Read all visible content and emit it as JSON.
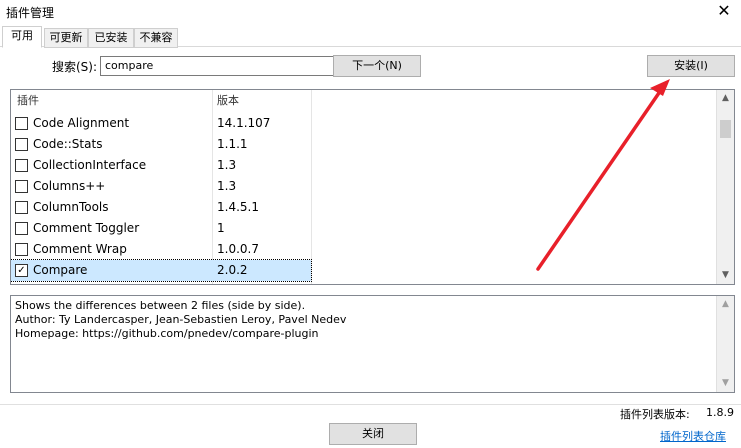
{
  "window": {
    "title": "插件管理"
  },
  "tabs": [
    {
      "label": "可用"
    },
    {
      "label": "可更新"
    },
    {
      "label": "已安装"
    },
    {
      "label": "不兼容"
    }
  ],
  "search": {
    "label": "搜索(S):",
    "value": "compare"
  },
  "buttons": {
    "next": "下一个(N)",
    "install": "安装(I)",
    "close": "关闭"
  },
  "list": {
    "headers": {
      "name": "插件",
      "version": "版本"
    },
    "rows": [
      {
        "name": "Code Alignment",
        "version": "14.1.107",
        "checked": ""
      },
      {
        "name": "Code::Stats",
        "version": "1.1.1",
        "checked": ""
      },
      {
        "name": "CollectionInterface",
        "version": "1.3",
        "checked": ""
      },
      {
        "name": "Columns++",
        "version": "1.3",
        "checked": ""
      },
      {
        "name": "ColumnTools",
        "version": "1.4.5.1",
        "checked": ""
      },
      {
        "name": "Comment Toggler",
        "version": "1",
        "checked": ""
      },
      {
        "name": "Comment Wrap",
        "version": "1.0.0.7",
        "checked": ""
      },
      {
        "name": "Compare",
        "version": "2.0.2",
        "checked": "✓"
      }
    ]
  },
  "description": {
    "lines": [
      "Shows the differences between 2 files (side by side).",
      "Author: Ty Landercasper, Jean-Sebastien Leroy, Pavel Nedev",
      "Homepage: https://github.com/pnedev/compare-plugin"
    ]
  },
  "footer": {
    "list_version_label": "插件列表版本:",
    "list_version": "1.8.9",
    "repo_link": "插件列表仓库"
  },
  "colors": {
    "selection": "#cce8ff",
    "link": "#0066cc",
    "arrow": "#e8202a"
  }
}
